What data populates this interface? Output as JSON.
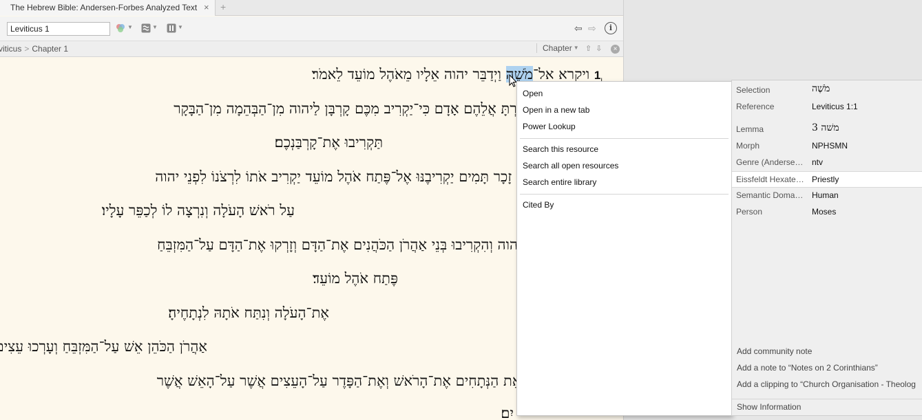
{
  "tab": {
    "title": "The Hebrew Bible: Andersen-Forbes Analyzed Text",
    "close": "×",
    "new": "+"
  },
  "toolbar": {
    "reference_value": "Leviticus 1",
    "back": "⇦",
    "forward": "⇨",
    "info": "i"
  },
  "breadcrumb": {
    "book": "viticus",
    "separator": ">",
    "chapter": "Chapter 1"
  },
  "nav": {
    "mode": "Chapter",
    "up": "⇧",
    "down": "⇩",
    "close": "×"
  },
  "text": {
    "verse_number": "1",
    "verse_marker": "ו",
    "line1_before": "ויקרא אל־",
    "line1_selected": "מֹשֶׁה",
    "line1_after": " וַיְדַבֵּר יהוה אֵלָיו מֵאֹהֶל מוֹעֵד לֵאמֹר׃",
    "line2": "בְּנֵי יִשְׂרָאֵל וְאָמַרְתָּ אֲלֵהֶם אָדָם כִּי־יַקְרִיב מִכֶּם קָרְבָּן לַיהוה מִן־הַבְּהֵמָה מִן־הַבָּקָר",
    "line3": "תַּקְרִיבוּ אֶת־קָרְבַּנְכֶם׃",
    "line4": "קָרְבָּנוֹ מִן־הַבָּקָר זָכָר תָּמִים יַקְרִיבֶנּוּ אֶל־פֶּתַח אֹהֶל מוֹעֵד יַקְרִיב אֹתוֹ לִרְצֹנוֹ לִפְנֵי יהוה",
    "line5": "עַל רֹאשׁ הָעֹלָה וְנִרְצָה לוֹ לְכַפֵּר עָלָיו׃",
    "line6": "בֶּן הַבָּקָר לִפְנֵי יהוה וְהִקְרִיבוּ בְּנֵי אַהֲרֹן הַכֹּהֲנִים אֶת־הַדָּם וְזָרְקוּ אֶת־הַדָּם עַל־הַמִּזְבֵּחַ",
    "line7": "פֶּתַח אֹהֶל מוֹעֵד׃",
    "line8": "אֶת־הָעֹלָה וְנִתַּח אֹתָהּ לִנְתָחֶיהָ׃",
    "line9": "אַהֲרֹן הַכֹּהֵן אֵשׁ עַל־הַמִּזְבֵּחַ וְעָרְכוּ עֵצִים עַל־הָאֵשׁ׃",
    "line10": "אַהֲרֹן הַכֹּהֲנִים אֵת הַנְּתָחִים אֶת־הָרֹאשׁ וְאֶת־הַפָּדֶר עַל־הָעֵצִים אֲשֶׁר עַל־הָאֵשׁ אֲשֶׁר",
    "line11": "יִם׃"
  },
  "context_menu": {
    "items": [
      "Open",
      "Open in a new tab",
      "Power Lookup",
      "Search this resource",
      "Search all open resources",
      "Search entire library",
      "Cited By"
    ]
  },
  "info_panel": {
    "rows": [
      {
        "label": "Selection",
        "value": "מֹשֶׁה"
      },
      {
        "label": "Reference",
        "value": "Leviticus 1:1"
      },
      {
        "label": "Lemma",
        "value": "משׁה 3"
      },
      {
        "label": "Morph",
        "value": "NPHSMN"
      },
      {
        "label": "Genre (Anderse…",
        "value": "ntv"
      },
      {
        "label": "Eissfeldt Hexate…",
        "value": "Priestly"
      },
      {
        "label": "Semantic Doma…",
        "value": "Human"
      },
      {
        "label": "Person",
        "value": "Moses"
      }
    ],
    "actions": [
      "Add community note",
      "Add a note to “Notes on 2 Corinthians”",
      "Add a clipping to “Church Organisation - Theolog"
    ],
    "show_information": "Show Information"
  },
  "colors": {
    "page_background": "#fdf8ec",
    "selection_highlight": "#aed2f0",
    "panel_background": "#efefef"
  }
}
